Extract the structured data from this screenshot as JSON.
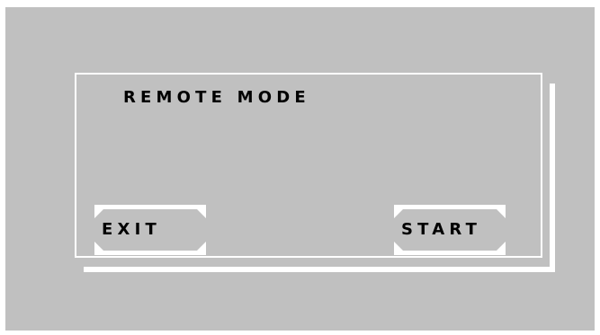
{
  "dialog": {
    "title": "REMOTE MODE",
    "exit_label": "EXIT",
    "start_label": "START"
  },
  "colors": {
    "background": "#c0c0c0",
    "frame": "#ffffff",
    "text": "#000000"
  }
}
